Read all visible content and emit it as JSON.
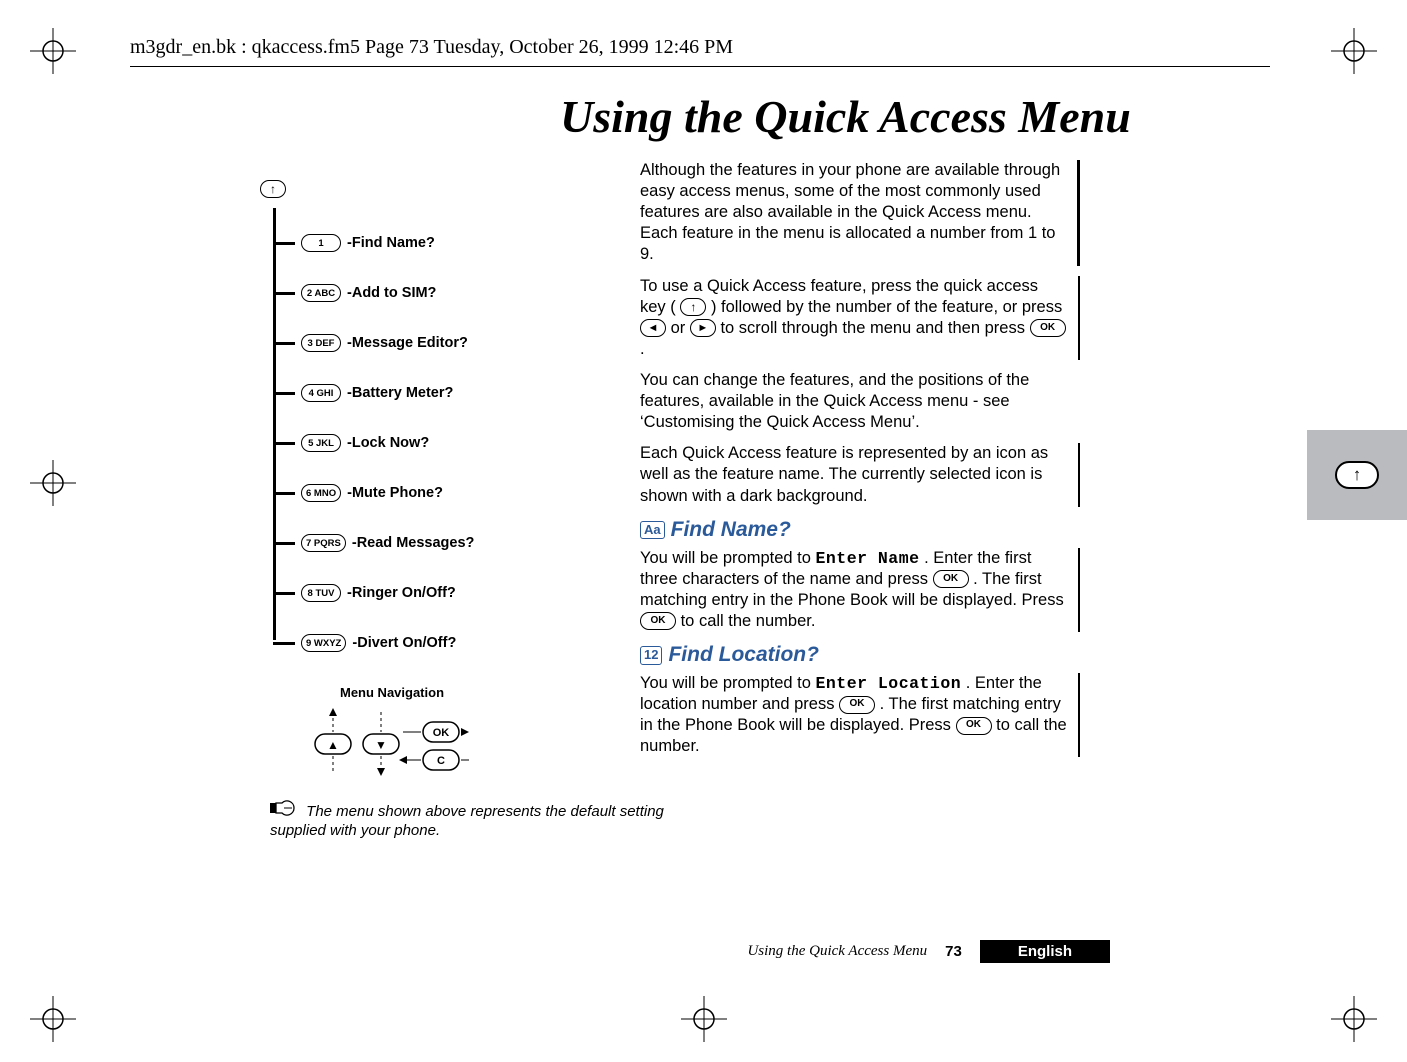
{
  "header_line": "m3gdr_en.bk : qkaccess.fm5  Page 73  Tuesday, October 26, 1999  12:46 PM",
  "title": "Using the Quick Access Menu",
  "tree": {
    "root_symbol": "↑",
    "items": [
      {
        "key": "1",
        "label": "Find Name?"
      },
      {
        "key": "2 ABC",
        "label": "Add to SIM?"
      },
      {
        "key": "3 DEF",
        "label": "Message Editor?"
      },
      {
        "key": "4 GHI",
        "label": "Battery Meter?"
      },
      {
        "key": "5 JKL",
        "label": "Lock Now?"
      },
      {
        "key": "6 MNO",
        "label": "Mute Phone?"
      },
      {
        "key": "7 PQRS",
        "label": "Read Messages?"
      },
      {
        "key": "8 TUV",
        "label": "Ringer On/Off?"
      },
      {
        "key": "9 WXYZ",
        "label": "Divert On/Off?"
      }
    ]
  },
  "menu_nav_label": "Menu Navigation",
  "nav_keys": {
    "up": "▲",
    "down": "▼",
    "ok": "OK",
    "clear": "C"
  },
  "foot_note": "The menu shown above represents the default setting supplied with your phone.",
  "body": {
    "intro1": "Although the features in your phone are available through easy access menus, some of the most commonly used features are also available in the Quick Access menu. Each feature in the menu is allocated a number from 1 to 9.",
    "intro2_a": "To use a Quick Access feature, press the quick access key (",
    "intro2_b": ") followed by the number of the feature, or press ",
    "intro2_c": " or ",
    "intro2_d": " to scroll through the menu and then press ",
    "intro2_e": ".",
    "intro3": "You can change the features, and the positions of the features, available in the Quick Access menu - see ‘Customising the Quick Access Menu’.",
    "intro4": "Each Quick Access feature is represented by an icon as well as the feature name. The currently selected icon is shown with a dark background.",
    "find_name_head": "Find Name?",
    "find_name_icon": "Aa",
    "find_name_a": "You will be prompted to ",
    "find_name_mono1": "Enter Name",
    "find_name_b": ". Enter the first three characters of the name and press ",
    "find_name_c": ". The first matching entry in the Phone Book will be displayed. Press ",
    "find_name_d": " to call the number.",
    "find_loc_head": "Find Location?",
    "find_loc_icon": "12",
    "find_loc_a": "You will be prompted to ",
    "find_loc_mono1": "Enter Location",
    "find_loc_b": ". Enter the location number and press ",
    "find_loc_c": ". The first matching entry in the Phone Book will be displayed. Press ",
    "find_loc_d": " to call the number."
  },
  "keys": {
    "ok": "OK",
    "quick": "↑",
    "left": "◄",
    "right": "►"
  },
  "side_tab_symbol": "↑",
  "footer": {
    "section": "Using the Quick Access Menu",
    "page": "73",
    "lang": "English"
  }
}
